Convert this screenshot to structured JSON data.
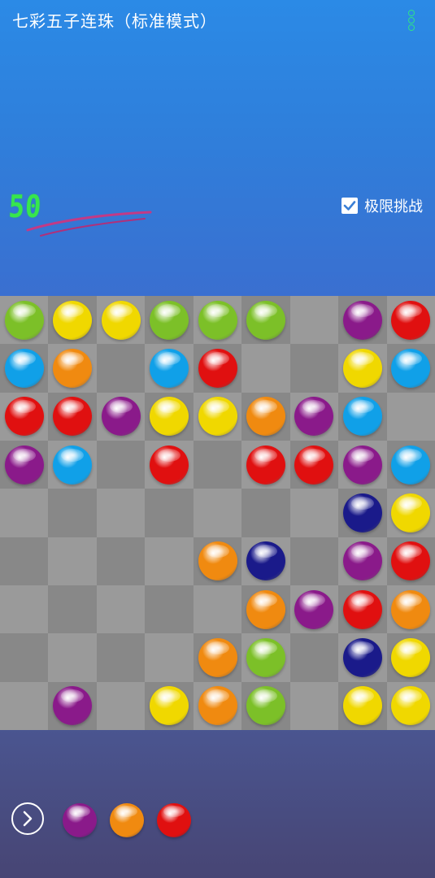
{
  "header": {
    "title": "七彩五子连珠（标准模式）",
    "menu_icon": "more-vertical-icon"
  },
  "score": "50",
  "challenge": {
    "label": "极限挑战",
    "checked": true
  },
  "colors": {
    "G": "#7cc028",
    "Y": "#f0d800",
    "P": "#8a1a8a",
    "R": "#e01010",
    "B": "#10a0e8",
    "O": "#f08a10",
    "N": "#1a1a8a"
  },
  "board_colors": {
    "light": "#9a9a9a",
    "dark": "#888888"
  },
  "board": [
    [
      "G",
      "Y",
      "Y",
      "G",
      "G",
      "G",
      "",
      "P",
      "R"
    ],
    [
      "B",
      "O",
      "",
      "B",
      "R",
      "",
      "",
      "Y",
      "B"
    ],
    [
      "R",
      "R",
      "P",
      "Y",
      "Y",
      "O",
      "P",
      "B",
      ""
    ],
    [
      "P",
      "B",
      "",
      "R",
      "",
      "R",
      "R",
      "P",
      "B"
    ],
    [
      "",
      "",
      "",
      "",
      "",
      "",
      "",
      "N",
      "Y"
    ],
    [
      "",
      "",
      "",
      "",
      "O",
      "N",
      "",
      "P",
      "R"
    ],
    [
      "",
      "",
      "",
      "",
      "",
      "O",
      "P",
      "R",
      "O"
    ],
    [
      "",
      "",
      "",
      "",
      "O",
      "G",
      "",
      "N",
      "Y"
    ],
    [
      "",
      "P",
      "",
      "Y",
      "O",
      "G",
      "",
      "Y",
      "Y"
    ]
  ],
  "next_balls": [
    "P",
    "O",
    "R"
  ],
  "next_icon": "chevron-right-circle-icon"
}
